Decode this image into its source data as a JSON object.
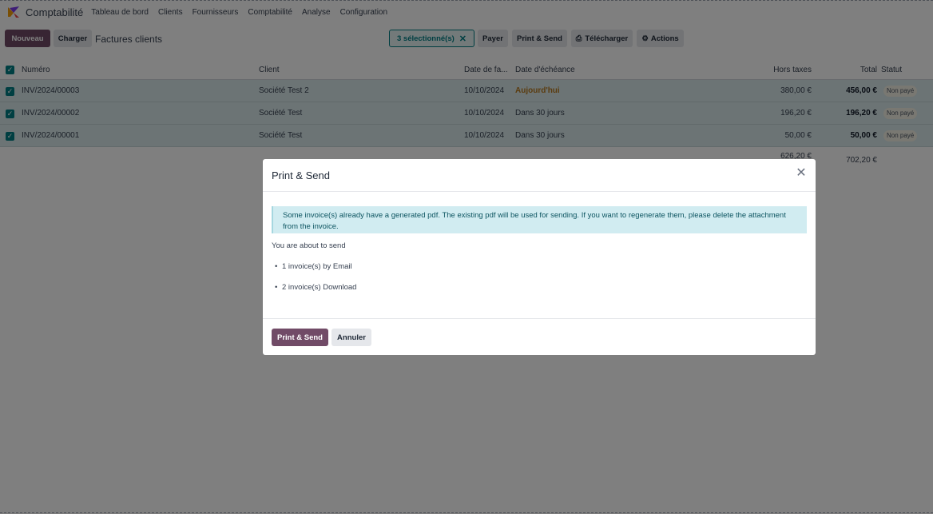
{
  "navbar": {
    "app_name": "Comptabilité",
    "items": [
      "Tableau de bord",
      "Clients",
      "Fournisseurs",
      "Comptabilité",
      "Analyse",
      "Configuration"
    ]
  },
  "control": {
    "new_label": "Nouveau",
    "upload_label": "Charger",
    "breadcrumb": "Factures clients",
    "selected_label": "3 sélectionné(s)",
    "pay_label": "Payer",
    "print_send_label": "Print & Send",
    "download_label": "Télécharger",
    "actions_label": "Actions"
  },
  "table": {
    "headers": {
      "number": "Numéro",
      "client": "Client",
      "invoice_date": "Date de fa...",
      "due_date": "Date d'échéance",
      "untaxed": "Hors taxes",
      "total": "Total",
      "status": "Statut"
    },
    "rows": [
      {
        "number": "INV/2024/00003",
        "client": "Société Test 2",
        "invoice_date": "10/10/2024",
        "due_date": "Aujourd'hui",
        "untaxed": "380,00 €",
        "total": "456,00 €",
        "status": "Non payé"
      },
      {
        "number": "INV/2024/00002",
        "client": "Société Test",
        "invoice_date": "10/10/2024",
        "due_date": "Dans 30 jours",
        "untaxed": "196,20 €",
        "total": "196,20 €",
        "status": "Non payé"
      },
      {
        "number": "INV/2024/00001",
        "client": "Société Test",
        "invoice_date": "10/10/2024",
        "due_date": "Dans 30 jours",
        "untaxed": "50,00 €",
        "total": "50,00 €",
        "status": "Non payé"
      }
    ],
    "sum_untaxed": "626,20 €",
    "sum_total": "702,20 €"
  },
  "modal": {
    "title": "Print & Send",
    "alert_line1": "Some invoice(s) already have a generated pdf. The existing pdf will be used for sending. If you want to regenerate them, please delete the attachment",
    "alert_line2": "from the invoice.",
    "about": "You are about to send",
    "items": [
      "1 invoice(s) by Email",
      "2 invoice(s) Download"
    ],
    "confirm_label": "Print & Send",
    "cancel_label": "Annuler"
  },
  "colors": {
    "brand": "#714b67",
    "accent": "#017e84",
    "row_selected": "#d8e8ea"
  }
}
